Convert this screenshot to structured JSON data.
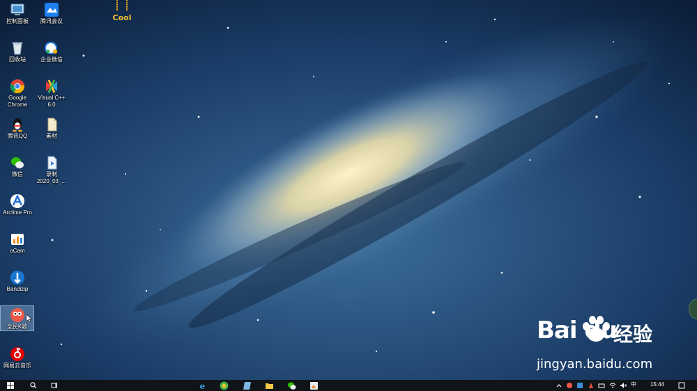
{
  "desktop": {
    "icons": [
      {
        "label": "控制面板",
        "icon": "control-panel-icon",
        "selected": false
      },
      {
        "label": "腾讯会议",
        "icon": "tencent-meeting-icon",
        "selected": false
      },
      {
        "label": "回收站",
        "icon": "recycle-bin-icon",
        "selected": false
      },
      {
        "label": "企业微信",
        "icon": "wecom-icon",
        "selected": false
      },
      {
        "label": "Google\nChrome",
        "icon": "chrome-icon",
        "selected": false
      },
      {
        "label": "Visual C++\n6.0",
        "icon": "visual-cpp-icon",
        "selected": false
      },
      {
        "label": "腾讯QQ",
        "icon": "qq-icon",
        "selected": false
      },
      {
        "label": "素材",
        "icon": "file-icon",
        "selected": false
      },
      {
        "label": "微信",
        "icon": "wechat-icon",
        "selected": false
      },
      {
        "label": "录制\n2020_03_...",
        "icon": "video-file-icon",
        "selected": false
      },
      {
        "label": "Arctime Pro",
        "icon": "arctime-icon",
        "selected": false
      },
      {
        "label": "oCam",
        "icon": "ocam-icon",
        "selected": false
      },
      {
        "label": "Bandizip",
        "icon": "bandizip-icon",
        "selected": false
      },
      {
        "label": "全民K歌",
        "icon": "kge-icon",
        "selected": true
      },
      {
        "label": "网易云音乐",
        "icon": "netease-music-icon",
        "selected": false
      }
    ],
    "sticker_text": "Cool"
  },
  "watermark": {
    "logo": "Bai  du",
    "chinese": "经验",
    "url": "jingyan.baidu.com"
  },
  "taskbar": {
    "start_icon": "windows-start-icon",
    "search_icon": "search-icon",
    "taskview_icon": "task-view-icon",
    "apps": [
      "ie-icon",
      "browser-360-icon",
      "notepad-icon",
      "file-explorer-icon",
      "wechat-icon",
      "media-icon"
    ],
    "tray": [
      "chevron-up-icon",
      "tray-app-icon",
      "tray-app-icon",
      "tray-app-icon",
      "tray-app-icon",
      "network-icon",
      "volume-icon",
      "ime-icon"
    ],
    "ime_label": "中",
    "time": "15:44"
  },
  "colors": {
    "taskbar": "#101418",
    "selection": "#9ebee6"
  }
}
